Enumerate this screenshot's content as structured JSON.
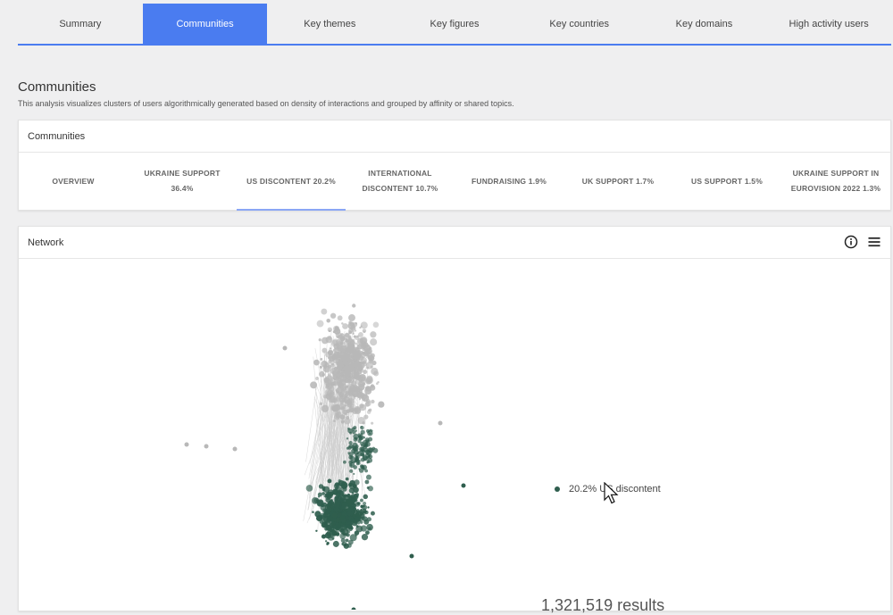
{
  "top_tabs": [
    {
      "label": "Summary",
      "active": false
    },
    {
      "label": "Communities",
      "active": true
    },
    {
      "label": "Key themes",
      "active": false
    },
    {
      "label": "Key figures",
      "active": false
    },
    {
      "label": "Key countries",
      "active": false
    },
    {
      "label": "Key domains",
      "active": false
    },
    {
      "label": "High activity users",
      "active": false
    }
  ],
  "page": {
    "title": "Communities",
    "description": "This analysis visualizes clusters of users algorithmically generated based on density of interactions and grouped by affinity or shared topics."
  },
  "communities_card": {
    "title": "Communities",
    "tabs": [
      {
        "label": "OVERVIEW",
        "active": false
      },
      {
        "label": "UKRAINE SUPPORT 36.4%",
        "active": false
      },
      {
        "label": "US DISCONTENT 20.2%",
        "active": true
      },
      {
        "label": "INTERNATIONAL DISCONTENT 10.7%",
        "active": false
      },
      {
        "label": "FUNDRAISING 1.9%",
        "active": false
      },
      {
        "label": "UK SUPPORT 1.7%",
        "active": false
      },
      {
        "label": "US SUPPORT 1.5%",
        "active": false
      },
      {
        "label": "UKRAINE SUPPORT IN EUROVISION 2022 1.3%",
        "active": false
      }
    ]
  },
  "network_card": {
    "title": "Network",
    "icons": [
      "info-icon",
      "menu-icon"
    ],
    "legend_label": "20.2% US discontent",
    "bottom_text": "1,321,519 results"
  },
  "colors": {
    "accent": "#4a7cf0",
    "active_underline": "#8aa6f5",
    "community_highlight": "#2f5e4e",
    "other_nodes": "#b8b8b8"
  }
}
